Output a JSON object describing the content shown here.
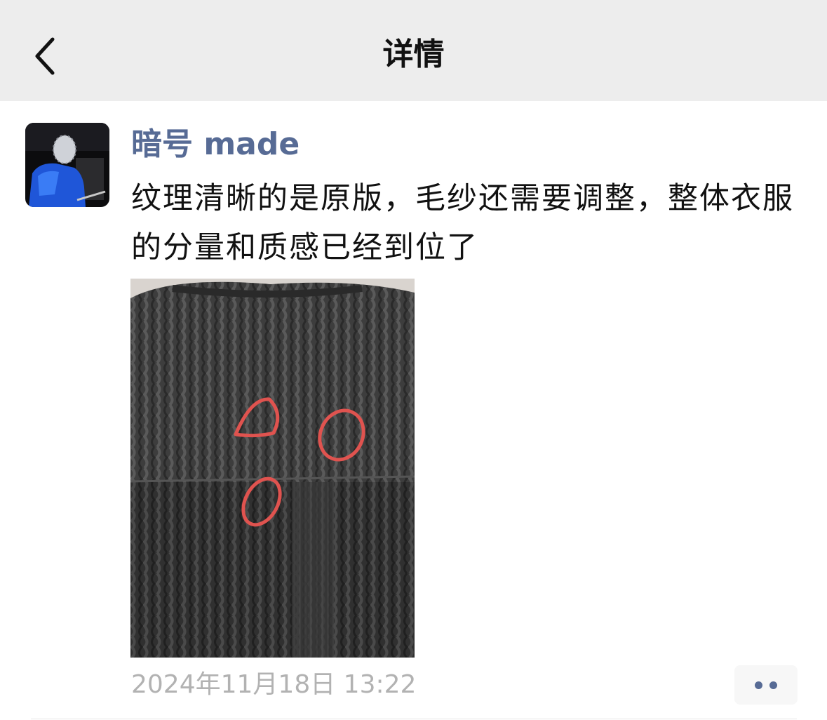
{
  "nav": {
    "title": "详情",
    "back_icon": "chevron-left-icon"
  },
  "post": {
    "author": "暗号 made",
    "text": "纹理清晰的是原版，毛纱还需要调整，整体衣服的分量和质感已经到位了",
    "timestamp": "2024年11月18日 13:22",
    "more_icon": "ellipsis-icon"
  },
  "colors": {
    "nav_background": "#ededed",
    "link": "#576b95",
    "timestamp": "#b2b2b2",
    "annotation": "#e0534f"
  }
}
